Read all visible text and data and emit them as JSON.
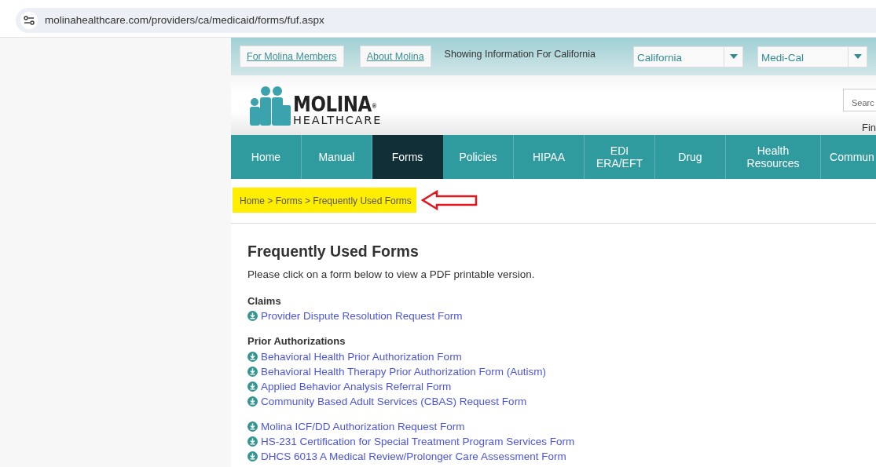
{
  "browser": {
    "url": "molinahealthcare.com/providers/ca/medicaid/forms/fuf.aspx"
  },
  "top_bar": {
    "links": [
      "For Molina Members",
      "About Molina"
    ],
    "info": "Showing Information For California",
    "selects": [
      {
        "value": "California"
      },
      {
        "value": "Medi-Cal"
      }
    ]
  },
  "logo": {
    "name": "MOLINA",
    "mark": "®",
    "tagline": "HEALTHCARE"
  },
  "search": {
    "placeholder": "Searc"
  },
  "header_link": "Fin",
  "nav": [
    {
      "label": "Home",
      "selected": false
    },
    {
      "label": "Manual",
      "selected": false
    },
    {
      "label": "Forms",
      "selected": true
    },
    {
      "label": "Policies",
      "selected": false
    },
    {
      "label": "HIPAA",
      "selected": false
    },
    {
      "label": "EDI ERA/EFT",
      "selected": false
    },
    {
      "label": "Drug",
      "selected": false
    },
    {
      "label": "Health Resources",
      "selected": false
    },
    {
      "label": "Commun",
      "selected": false
    }
  ],
  "breadcrumb": [
    "Home",
    "Forms",
    "Frequently Used Forms"
  ],
  "breadcrumb_separator": ">",
  "page": {
    "title": "Frequently Used Forms",
    "intro": "Please click on a form below to view a PDF printable version."
  },
  "groups": [
    {
      "heading": "Claims",
      "forms": [
        "Provider Dispute Resolution Request Form"
      ]
    },
    {
      "heading": "Prior Authorizations",
      "forms": [
        "Behavioral Health Prior Authorization Form",
        "Behavioral Health Therapy Prior Authorization Form (Autism)",
        "Applied Behavior Analysis Referral Form",
        "Community Based Adult Services (CBAS) Request Form"
      ]
    },
    {
      "forms": [
        "Molina ICF/DD Authorization Request Form",
        "HS-231 Certification for Special Treatment Program Services Form",
        "DHCS 6013 A Medical Review/Prolonger Care Assessment Form"
      ]
    }
  ]
}
